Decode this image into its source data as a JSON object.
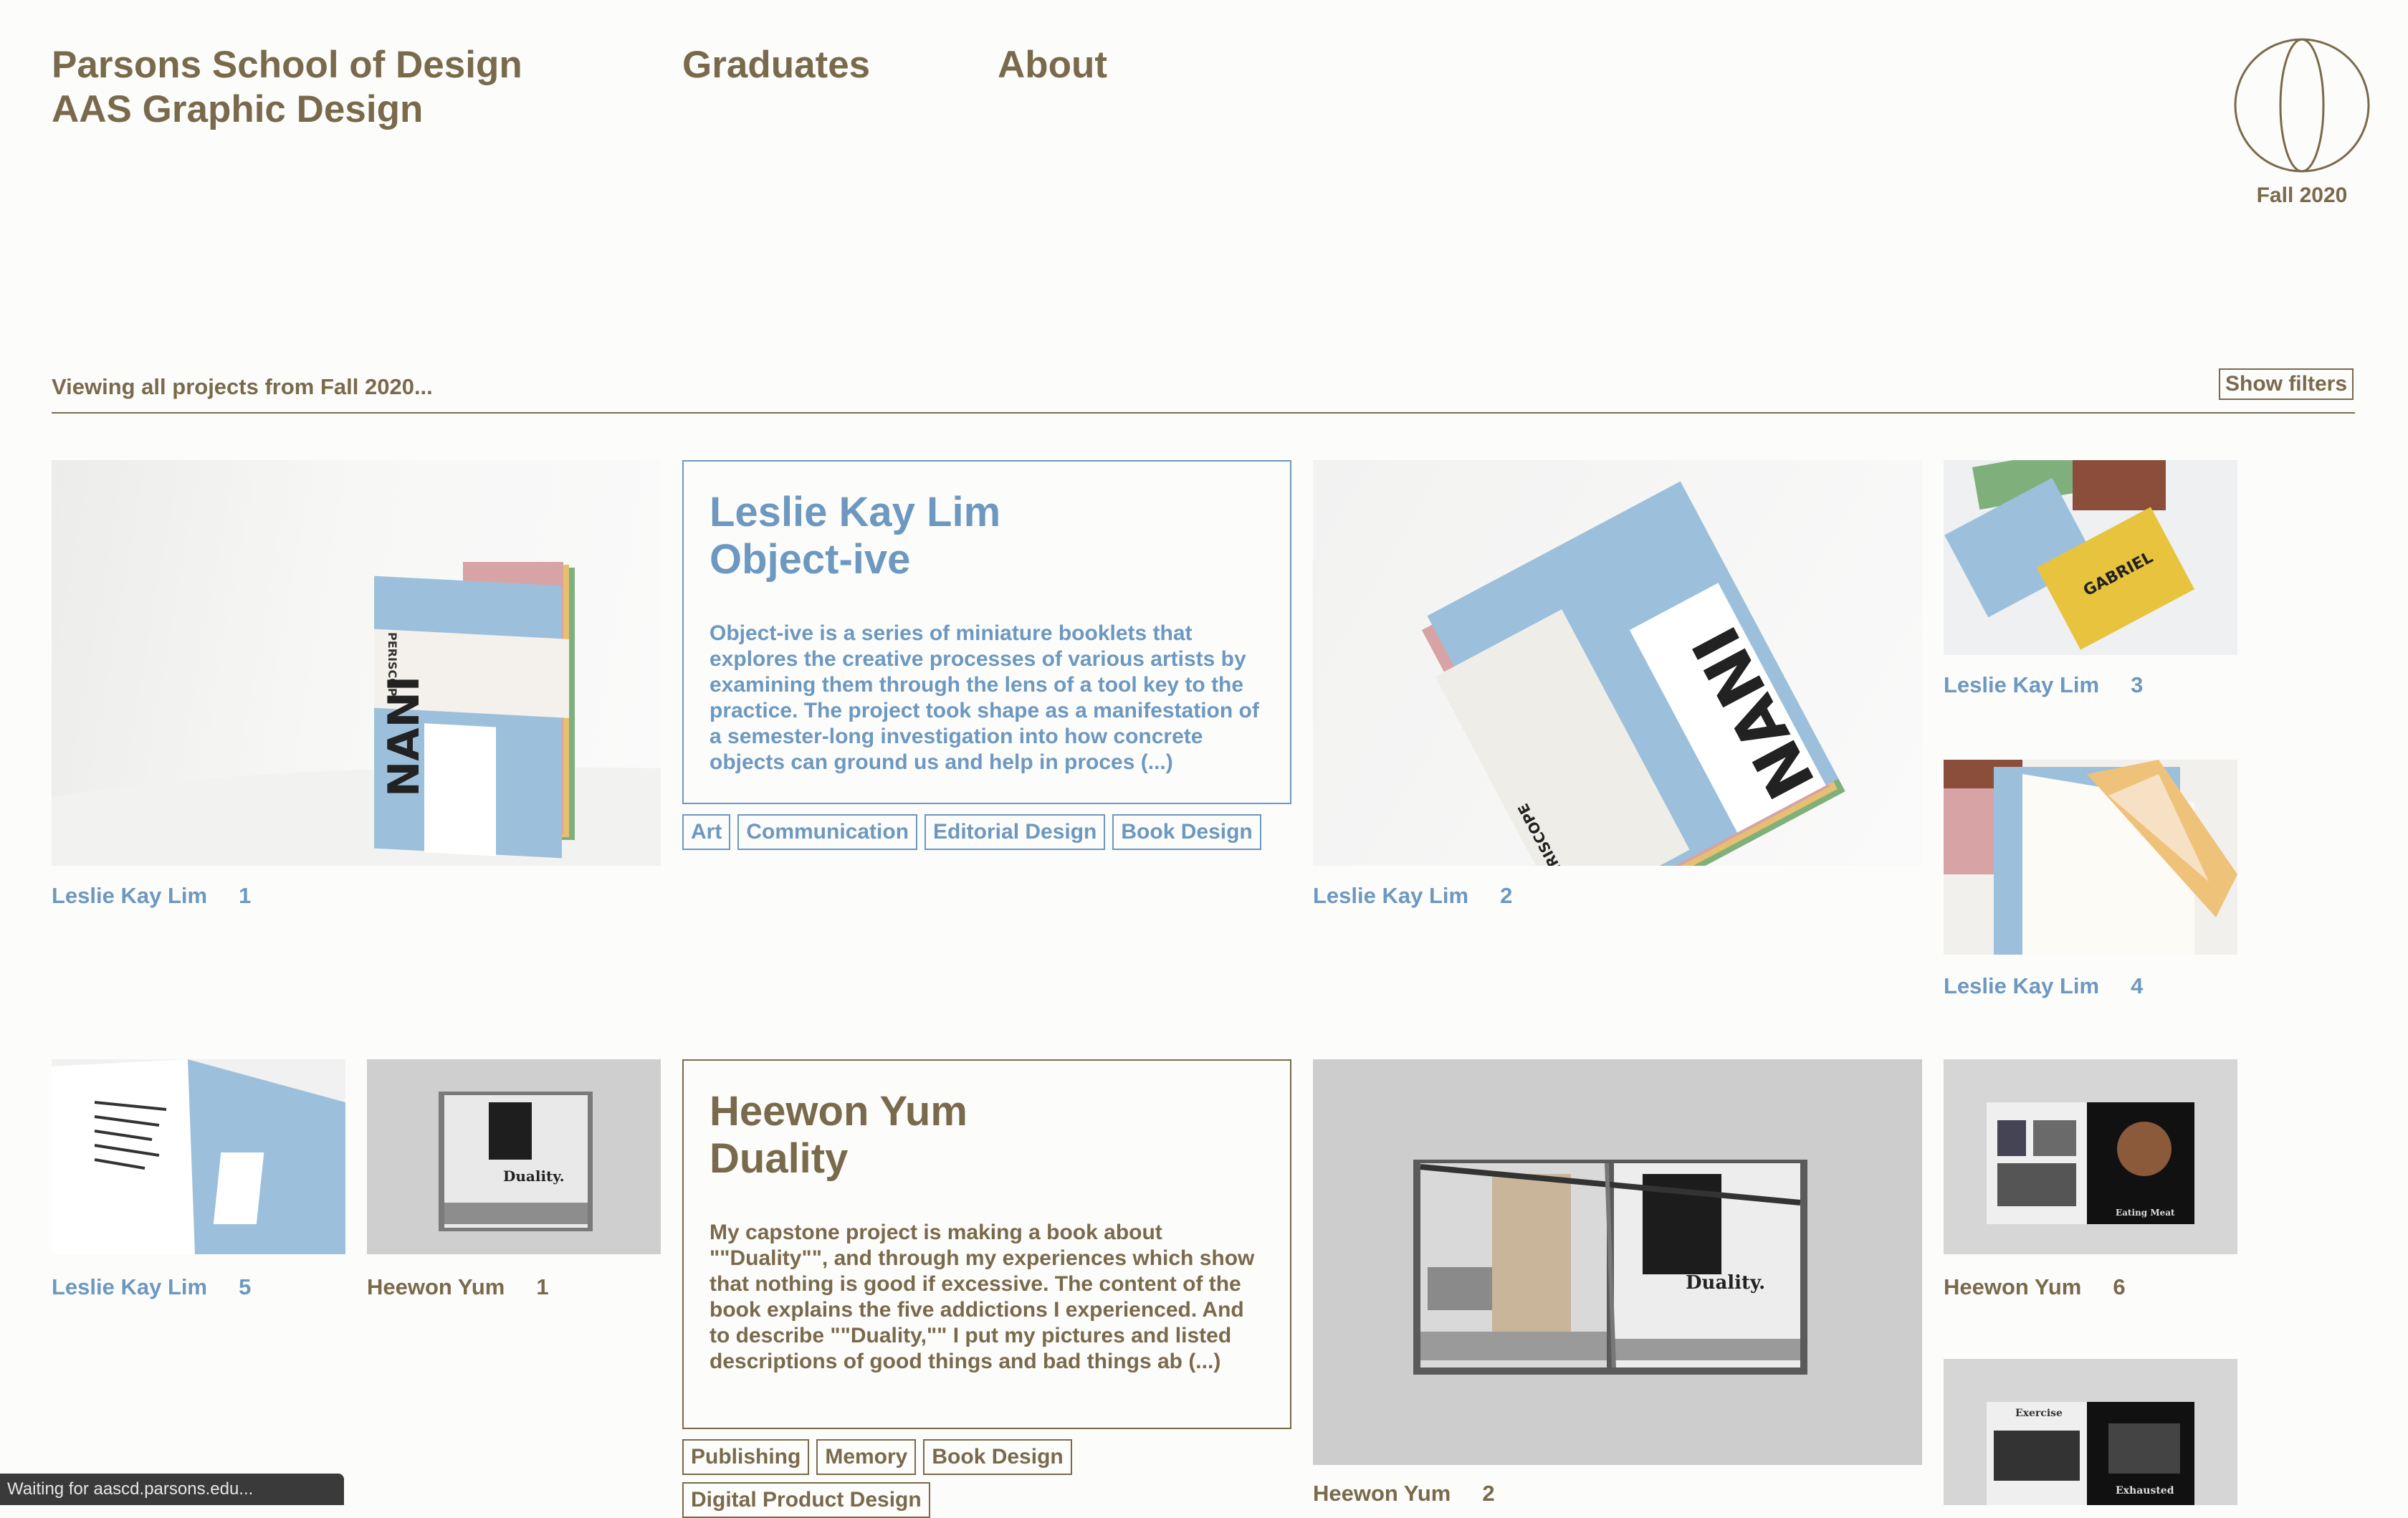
{
  "header": {
    "title_line1": "Parsons School of Design",
    "title_line2": "AAS Graphic Design",
    "nav": [
      "Graduates",
      "About"
    ],
    "semester": "Fall 2020"
  },
  "filter_bar": {
    "viewing": "Viewing all projects from Fall 2020...",
    "show_filters": "Show filters"
  },
  "projects": [
    {
      "student": "Leslie Kay Lim",
      "title": "Object-ive",
      "description": "Object-ive is a series of miniature booklets that explores the creative processes of various artists by examining them through the lens of a tool key to the practice. The project took shape as a manifestation of a semester-long investigation into how concrete objects can ground us and help in proces (...)",
      "tags": [
        "Art",
        "Communication",
        "Editorial Design",
        "Book Design"
      ],
      "thumbs": [
        {
          "name": "Leslie Kay Lim",
          "num": "1"
        },
        {
          "name": "Leslie Kay Lim",
          "num": "2"
        },
        {
          "name": "Leslie Kay Lim",
          "num": "3"
        },
        {
          "name": "Leslie Kay Lim",
          "num": "4"
        },
        {
          "name": "Leslie Kay Lim",
          "num": "5"
        }
      ]
    },
    {
      "student": "Heewon Yum",
      "title": "Duality",
      "description": "My capstone project is making a book about \"\"Duality\"\", and through my experiences which show that nothing is good if excessive. The content of the book explains the five addictions I experienced. And to describe \"\"Duality,\"\" I put my pictures and listed descriptions of good things and bad things ab (...)",
      "tags": [
        "Publishing",
        "Memory",
        "Book Design",
        "Digital Product Design"
      ],
      "thumbs": [
        {
          "name": "Heewon Yum",
          "num": "1"
        },
        {
          "name": "Heewon Yum",
          "num": "2"
        },
        {
          "name": "Heewon Yum",
          "num": "6"
        }
      ]
    }
  ],
  "image_text": {
    "periscope": "PERISCOPE",
    "nani": "NANI",
    "gabriel": "GABRIEL",
    "duality": "Duality.",
    "eating_meat": "Eating Meat",
    "exercise": "Exercise",
    "exhausted": "Exhausted"
  },
  "status": "Waiting for aascd.parsons.edu..."
}
